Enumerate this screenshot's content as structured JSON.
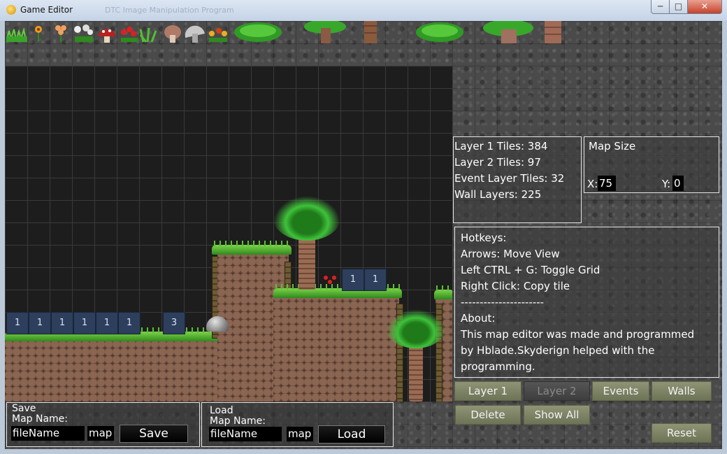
{
  "window": {
    "title": "Game Editor",
    "background_title": "DTC Image Manipulation Program"
  },
  "controls": {
    "minimize": "─",
    "maximize": "□",
    "close": "✕"
  },
  "palette": {
    "tiles": [
      "grass-tuft",
      "orange-flower",
      "orange-flower-2",
      "white-flowers",
      "red-mushroom",
      "red-flowers",
      "grass-blades",
      "brown-mushroom",
      "grey-mushroom",
      "yellow-flowers",
      "fern-bush",
      "palm-top",
      "tree-trunk",
      "fern-bush-2",
      "palm-top-2",
      "tree-trunk-2"
    ]
  },
  "map": {
    "event_tiles_row1": [
      "1",
      "1",
      "1",
      "1",
      "1",
      "1",
      "3"
    ],
    "event_tiles_row2": [
      "1",
      "1"
    ]
  },
  "stats": {
    "layer1": "Layer 1 Tiles: 384",
    "layer2": "Layer 2 Tiles: 97",
    "event": "Event Layer Tiles: 32",
    "walls": "Wall Layers: 225"
  },
  "map_size": {
    "title": "Map Size",
    "x_label": "X:",
    "x_value": "75",
    "y_label": "Y:",
    "y_value": "0"
  },
  "hotkeys": {
    "lines": [
      "Hotkeys:",
      "Arrows: Move View",
      "Left CTRL + G: Toggle Grid",
      "Right Click: Copy tile",
      "----------------------",
      "About:",
      "This map editor was made and programmed",
      "by Hblade.Skyderign helped with the",
      "programming."
    ]
  },
  "buttons": {
    "layer1": "Layer 1",
    "layer2": "Layer 2",
    "events": "Events",
    "walls": "Walls",
    "delete": "Delete",
    "show_all": "Show All",
    "reset": "Reset"
  },
  "save": {
    "heading": "Save",
    "label": "Map Name:",
    "value": "fileName",
    "ext": "map",
    "button": "Save"
  },
  "load": {
    "heading": "Load",
    "label": "Map Name:",
    "value": "fileName",
    "ext": "map",
    "button": "Load"
  },
  "colors": {
    "accent_button": "#7e8466",
    "field_bg": "#000000",
    "close_button": "#c6412b"
  }
}
